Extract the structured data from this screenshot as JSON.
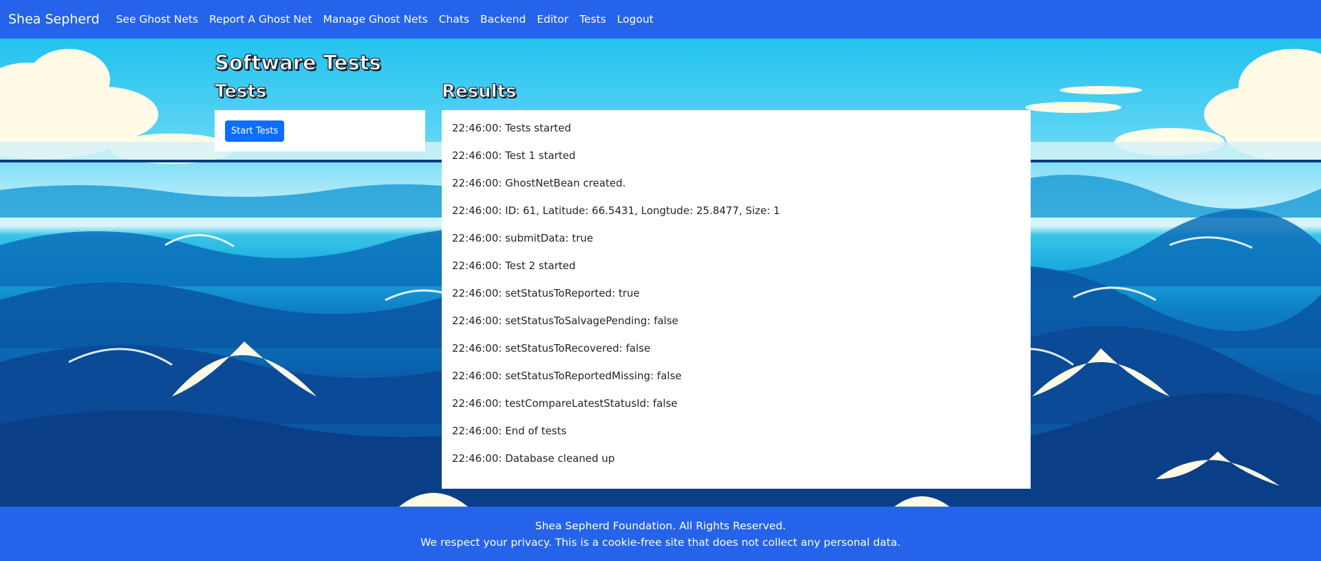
{
  "navbar": {
    "brand": "Shea Sepherd",
    "links": [
      {
        "label": "See Ghost Nets"
      },
      {
        "label": "Report A Ghost Net"
      },
      {
        "label": "Manage Ghost Nets"
      },
      {
        "label": "Chats"
      },
      {
        "label": "Backend"
      },
      {
        "label": "Editor"
      },
      {
        "label": "Tests"
      },
      {
        "label": "Logout"
      }
    ]
  },
  "main": {
    "title": "Software Tests",
    "tests": {
      "heading": "Tests",
      "start_button": "Start Tests"
    },
    "results": {
      "heading": "Results",
      "lines": [
        "22:46:00: Tests started",
        "22:46:00: Test 1 started",
        "22:46:00: GhostNetBean created.",
        "22:46:00: ID: 61, Latitude: 66.5431, Longtude: 25.8477, Size: 1",
        "22:46:00: submitData: true",
        "22:46:00: Test 2 started",
        "22:46:00: setStatusToReported: true",
        "22:46:00: setStatusToSalvagePending: false",
        "22:46:00: setStatusToRecovered: false",
        "22:46:00: setStatusToReportedMissing: false",
        "22:46:00: testCompareLatestStatusId: false",
        "22:46:00: End of tests",
        "22:46:00: Database cleaned up"
      ]
    }
  },
  "footer": {
    "line1": "Shea Sepherd Foundation. All Rights Reserved.",
    "line2": "We respect your privacy. This is a cookie-free site that does not collect any personal data."
  },
  "colors": {
    "navbar": "#2563eb",
    "footer": "#2563eb",
    "button": "#0d6efd",
    "sky": "#22c2ee",
    "ocean": "#0a4c98"
  }
}
